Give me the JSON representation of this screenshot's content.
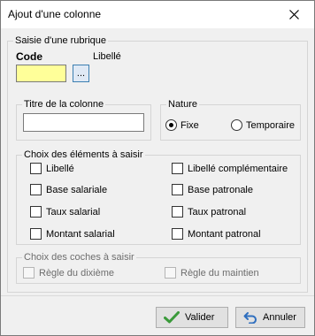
{
  "window": {
    "title": "Ajout d'une colonne"
  },
  "rubrique": {
    "legend": "Saisie d'une rubrique",
    "code_label": "Code",
    "libelle_label": "Libellé",
    "code_value": "",
    "lookup_label": "..."
  },
  "titre": {
    "legend": "Titre de la colonne",
    "value": ""
  },
  "nature": {
    "legend": "Nature",
    "options": [
      {
        "label": "Fixe",
        "selected": true
      },
      {
        "label": "Temporaire",
        "selected": false
      }
    ]
  },
  "elements": {
    "legend": "Choix des éléments à saisir",
    "items": [
      {
        "label": "Libellé",
        "checked": false
      },
      {
        "label": "Libellé complémentaire",
        "checked": false
      },
      {
        "label": "Base salariale",
        "checked": false
      },
      {
        "label": "Base patronale",
        "checked": false
      },
      {
        "label": "Taux salarial",
        "checked": false
      },
      {
        "label": "Taux patronal",
        "checked": false
      },
      {
        "label": "Montant salarial",
        "checked": false
      },
      {
        "label": "Montant patronal",
        "checked": false
      }
    ]
  },
  "coches": {
    "legend": "Choix des coches à saisir",
    "items": [
      {
        "label": "Règle du dixième",
        "checked": false,
        "enabled": false
      },
      {
        "label": "Règle du maintien",
        "checked": false,
        "enabled": false
      }
    ]
  },
  "buttons": {
    "valider": "Valider",
    "annuler": "Annuler"
  },
  "colors": {
    "code_field": "#ffff99",
    "valider_icon": "#3a9a3a",
    "annuler_icon": "#2f6fbf"
  }
}
